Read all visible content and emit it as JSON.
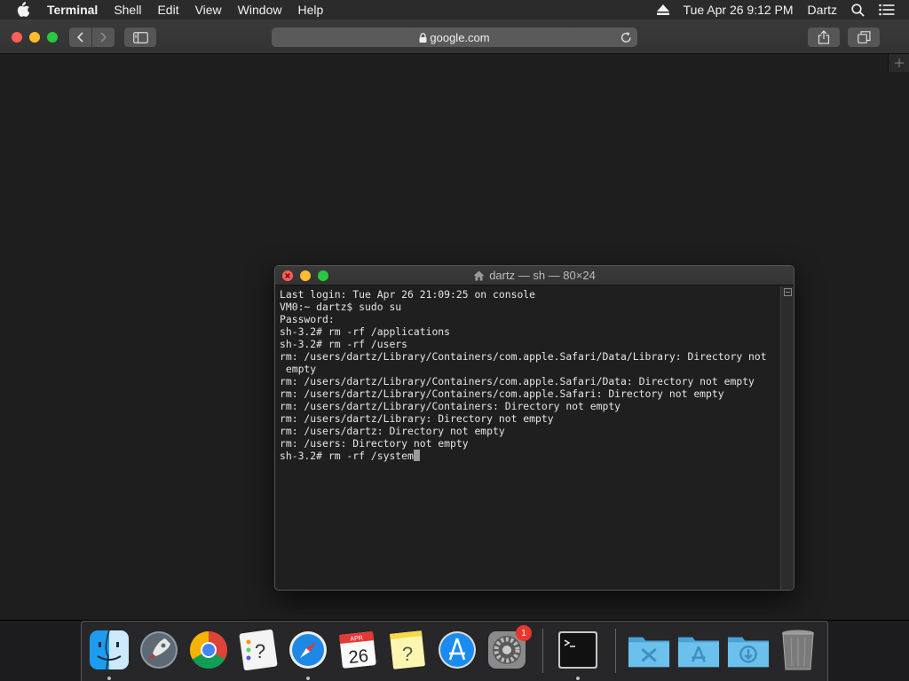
{
  "menubar": {
    "app_name": "Terminal",
    "items": [
      "Shell",
      "Edit",
      "View",
      "Window",
      "Help"
    ],
    "clock": "Tue Apr 26  9:12 PM",
    "user": "Dartz"
  },
  "safari": {
    "url": "google.com"
  },
  "terminal": {
    "title": "dartz — sh — 80×24",
    "lines": [
      "Last login: Tue Apr 26 21:09:25 on console",
      "VM0:~ dartz$ sudo su",
      "Password:",
      "sh-3.2# rm -rf /applications",
      "sh-3.2# rm -rf /users",
      "rm: /users/dartz/Library/Containers/com.apple.Safari/Data/Library: Directory not",
      " empty",
      "rm: /users/dartz/Library/Containers/com.apple.Safari/Data: Directory not empty",
      "rm: /users/dartz/Library/Containers/com.apple.Safari: Directory not empty",
      "rm: /users/dartz/Library/Containers: Directory not empty",
      "rm: /users/dartz/Library: Directory not empty",
      "rm: /users/dartz: Directory not empty",
      "rm: /users: Directory not empty",
      "sh-3.2# rm -rf /system"
    ]
  },
  "dock": {
    "items": [
      {
        "icon": "finder-icon",
        "running": true
      },
      {
        "icon": "launchpad-icon",
        "running": false
      },
      {
        "icon": "chrome-icon",
        "running": false
      },
      {
        "icon": "reminders-icon",
        "running": false
      },
      {
        "icon": "safari-icon",
        "running": true
      },
      {
        "icon": "calendar-icon",
        "label": "26",
        "month": "APR",
        "running": false
      },
      {
        "icon": "notes-icon",
        "running": false
      },
      {
        "icon": "app-store-icon",
        "running": false
      },
      {
        "icon": "system-preferences-icon",
        "badge": "1",
        "running": false
      },
      {
        "icon": "terminal-icon",
        "running": true
      },
      {
        "icon": "applications-folder-icon",
        "running": false
      },
      {
        "icon": "app-folder-icon",
        "running": false
      },
      {
        "icon": "downloads-folder-icon",
        "running": false
      },
      {
        "icon": "trash-icon",
        "running": false
      }
    ]
  },
  "colors": {
    "close": "#fe5f57",
    "minimize": "#febc2e",
    "zoom": "#28c840",
    "badge": "#e8372f"
  }
}
